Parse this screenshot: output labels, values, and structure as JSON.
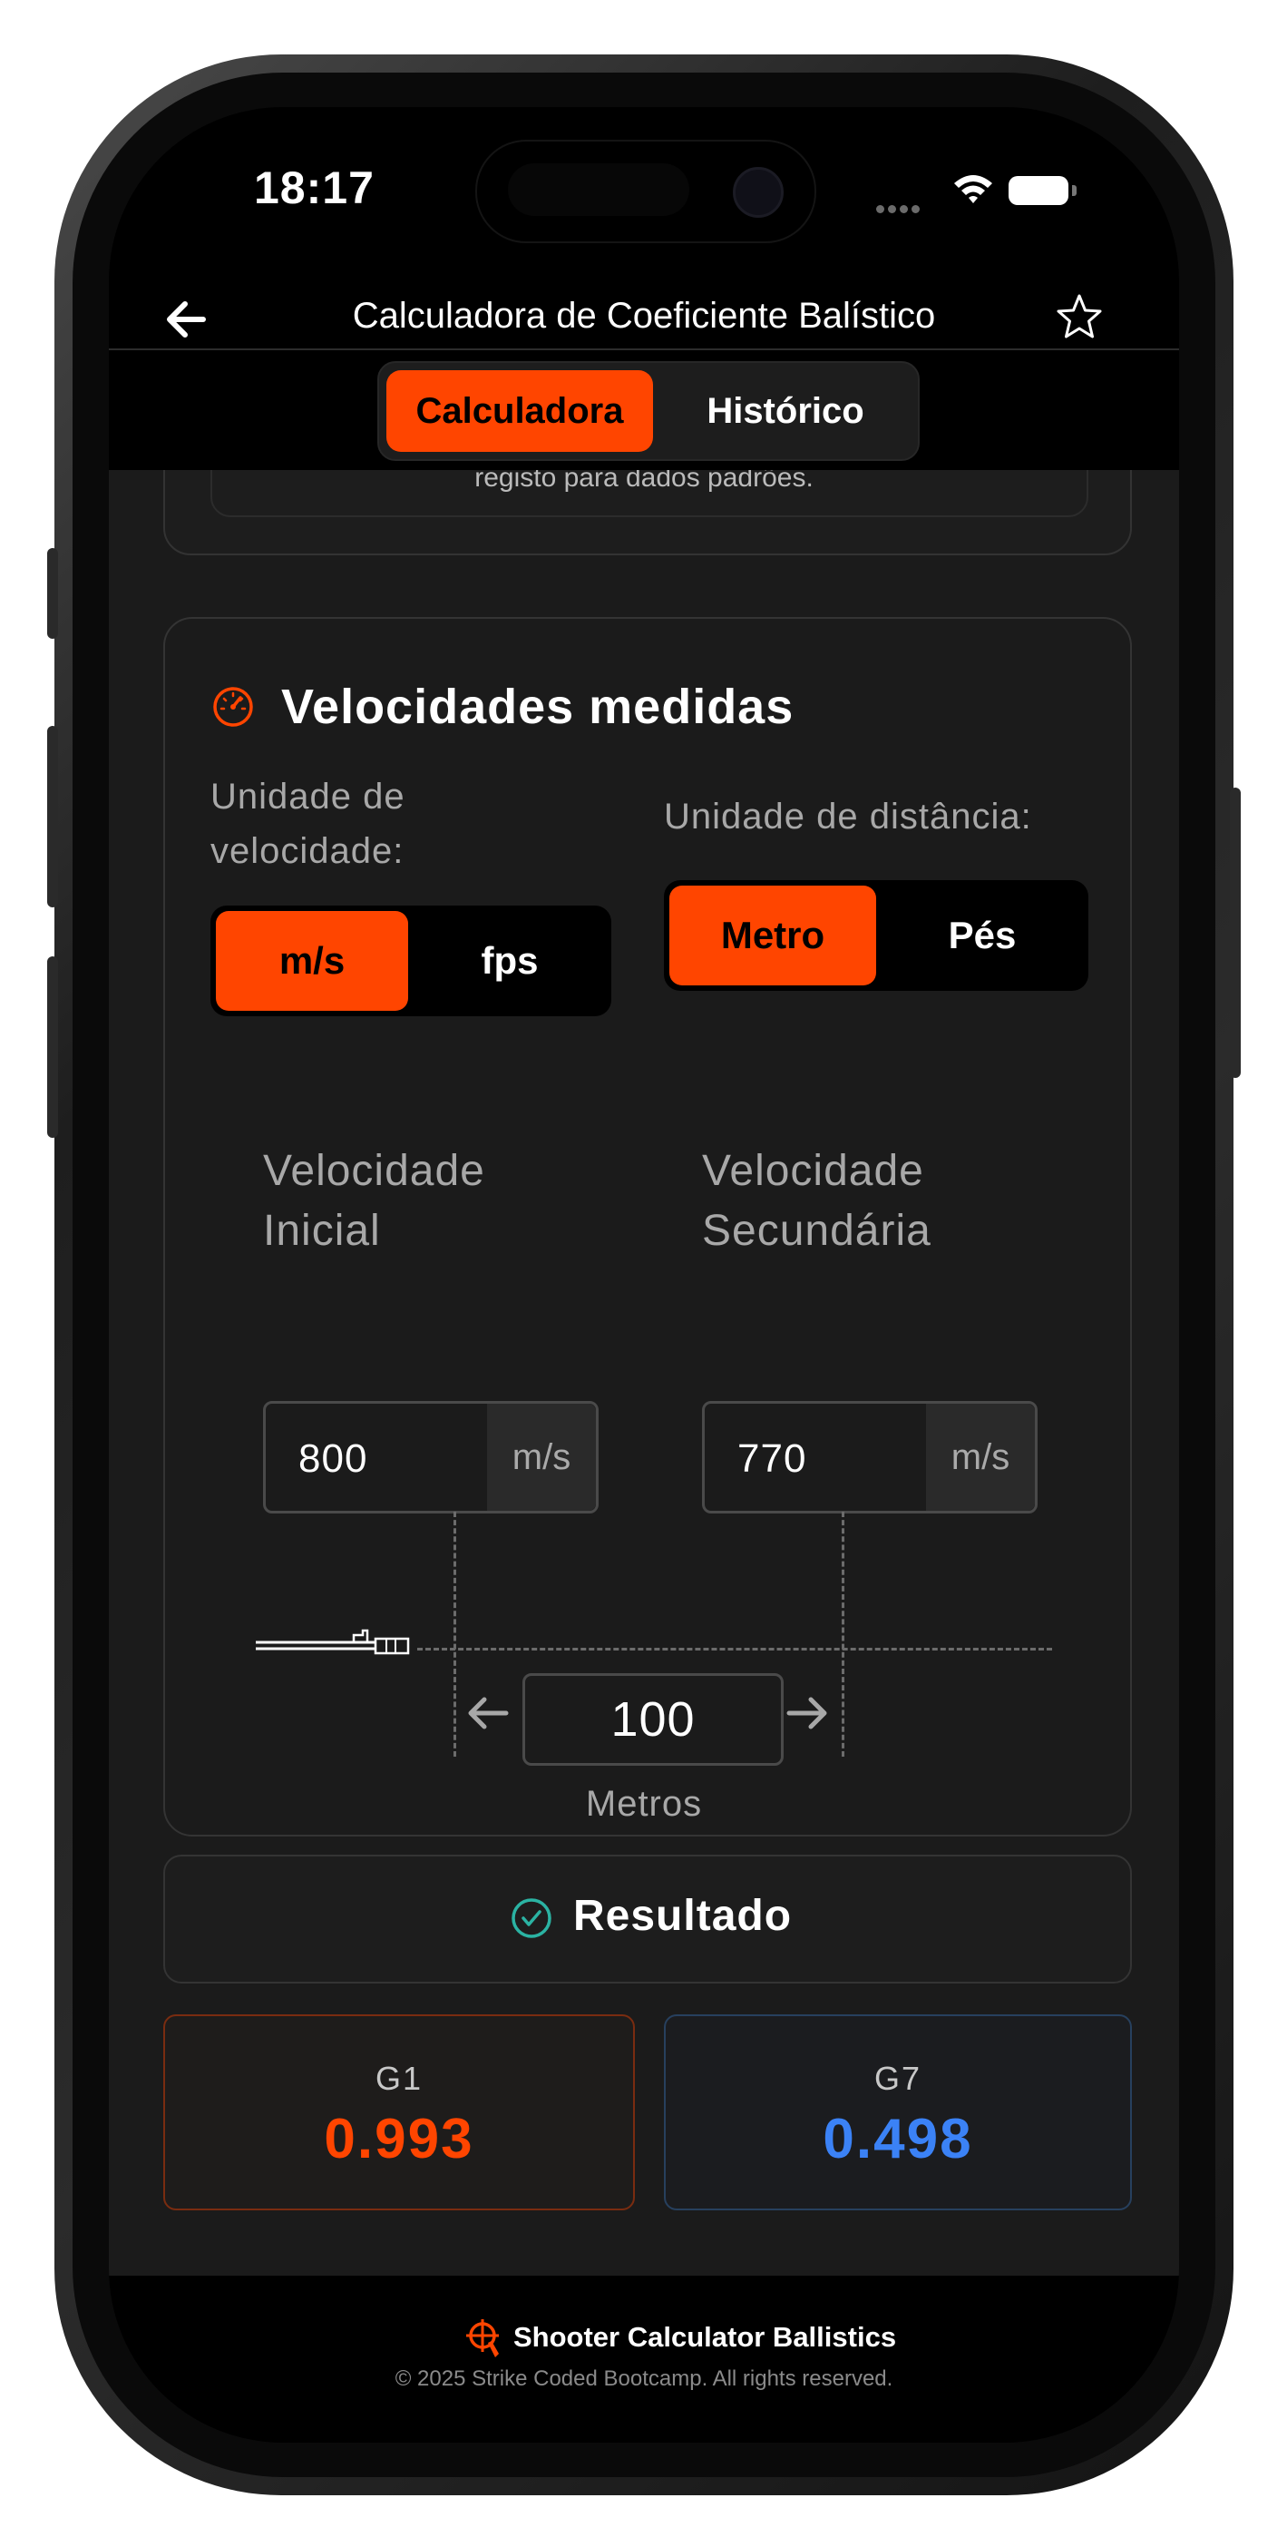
{
  "status_bar": {
    "time": "18:17"
  },
  "header": {
    "title": "Calculadora de Coeficiente Balístico"
  },
  "tabs": {
    "calc": "Calculadora",
    "hist": "Histórico"
  },
  "previous_card": {
    "text": "registo para dados padrões."
  },
  "velocities": {
    "title": "Velocidades medidas",
    "speed_unit_label": "Unidade de velocidade:",
    "speed_units": [
      "m/s",
      "fps"
    ],
    "speed_unit_selected": "m/s",
    "distance_unit_label": "Unidade de distância:",
    "distance_units": [
      "Metro",
      "Pés"
    ],
    "distance_unit_selected": "Metro",
    "initial": {
      "label": "Velocidade Inicial",
      "value": "800",
      "unit": "m/s"
    },
    "secondary": {
      "label": "Velocidade Secundária",
      "value": "770",
      "unit": "m/s"
    },
    "distance": {
      "value": "100",
      "unit": "Metros"
    }
  },
  "result": {
    "title": "Resultado",
    "g1": {
      "label": "G1",
      "value": "0.993",
      "color": "#ff4500"
    },
    "g7": {
      "label": "G7",
      "value": "0.498",
      "color": "#3b82f6"
    }
  },
  "footer": {
    "brand": "Shooter Calculator Ballistics",
    "copyright": "© 2025 Strike Coded Bootcamp. All rights reserved."
  },
  "colors": {
    "accent": "#ff4500",
    "background": "#1b1b1b"
  }
}
